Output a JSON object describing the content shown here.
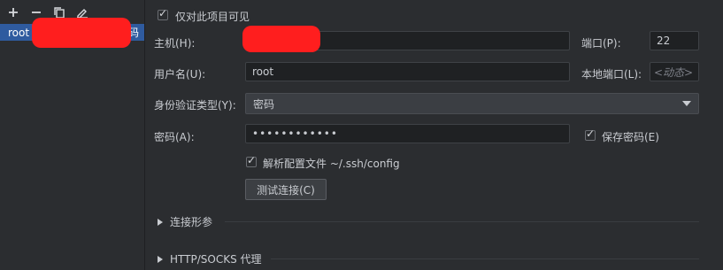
{
  "toolbar": {
    "add": "add-icon",
    "remove": "remove-icon",
    "copy": "copy-icon",
    "edit": "edit-icon"
  },
  "server_list": {
    "items": [
      {
        "label_start": "root",
        "label_end": "码"
      }
    ]
  },
  "form": {
    "visible_only_label": "仅对此项目可见",
    "host_label": "主机(H):",
    "port_label": "端口(P):",
    "port_value": "22",
    "username_label": "用户名(U):",
    "username_value": "root",
    "local_port_label": "本地端口(L):",
    "local_port_value": "<动态>",
    "auth_type_label": "身份验证类型(Y):",
    "auth_type_value": "密码",
    "password_label": "密码(A):",
    "password_value": "••••••••••••",
    "save_password_label": "保存密码(E)",
    "parse_config_label": "解析配置文件 ~/.ssh/config",
    "test_connection_button": "测试连接(C)",
    "section_connection_params": "连接形参",
    "section_proxy": "HTTP/SOCKS 代理"
  },
  "colors": {
    "selection": "#2f5b9f",
    "background": "#2b2d30",
    "redaction": "#ff1e1e"
  }
}
